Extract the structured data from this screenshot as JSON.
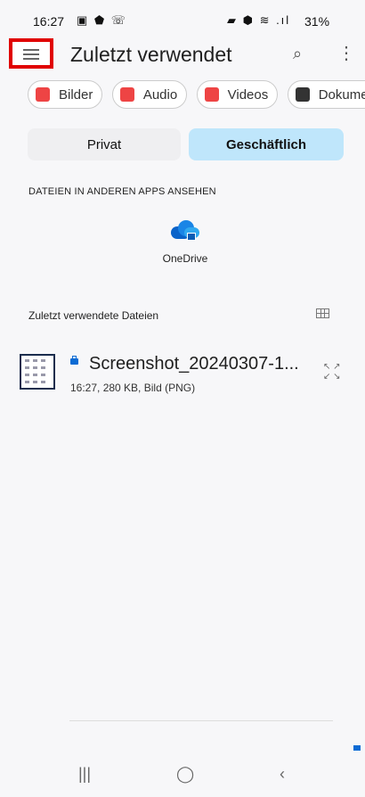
{
  "status": {
    "time": "16:27",
    "battery": "31%"
  },
  "appbar": {
    "title": "Zuletzt verwendet"
  },
  "chips": [
    {
      "label": "Bilder",
      "icon": "image-icon"
    },
    {
      "label": "Audio",
      "icon": "headphones-icon"
    },
    {
      "label": "Videos",
      "icon": "video-icon"
    },
    {
      "label": "Dokumente",
      "icon": "document-icon"
    }
  ],
  "toggle": {
    "private": "Privat",
    "business": "Geschäftlich"
  },
  "apps": {
    "heading": "DATEIEN IN ANDEREN APPS ANSEHEN",
    "onedrive": "OneDrive"
  },
  "recent": {
    "heading": "Zuletzt verwendete Dateien"
  },
  "file": {
    "name": "Screenshot_20240307-1...",
    "meta": "16:27, 280 KB, Bild (PNG)"
  }
}
